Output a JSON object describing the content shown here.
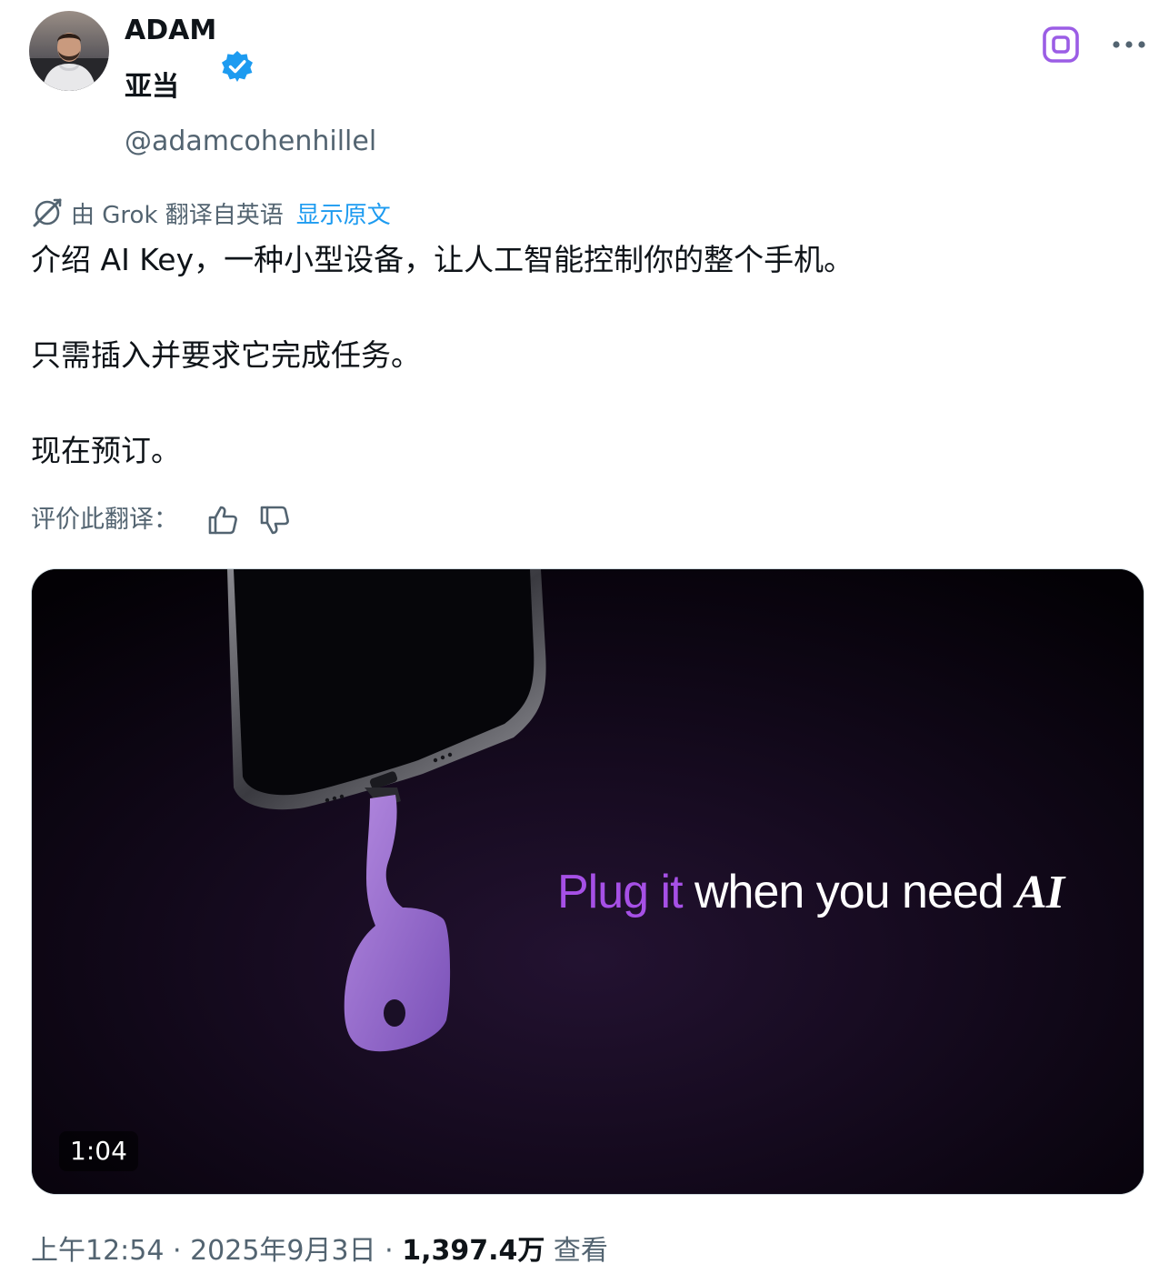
{
  "author": {
    "name_en": "ADAM",
    "name_zh": "亚当",
    "handle": "@adamcohenhillel",
    "verified": true,
    "avatar_icon": "person-avatar"
  },
  "header_actions": {
    "grok_icon": "grok-icon",
    "more_icon": "more-icon"
  },
  "translation": {
    "icon": "grok-translate-icon",
    "label": "由 Grok 翻译自英语",
    "show_original": "显示原文"
  },
  "tweet": {
    "lines": [
      "介绍 AI Key，一种小型设备，让人工智能控制你的整个手机。",
      "只需插入并要求它完成任务。",
      "现在预订。"
    ]
  },
  "rate_translation": {
    "label": "评价此翻译：",
    "thumbs_up_icon": "thumbs-up-icon",
    "thumbs_down_icon": "thumbs-down-icon"
  },
  "video": {
    "caption_highlight": "Plug it",
    "caption_rest": " when you need ",
    "caption_ai": "AI",
    "duration": "1:04"
  },
  "meta": {
    "time": "上午12:54",
    "sep1": " · ",
    "date": "2025年9月3日",
    "sep2": " · ",
    "views": "1,397.4万",
    "views_label": " 查看"
  },
  "colors": {
    "text_primary": "#0f1419",
    "text_secondary": "#536471",
    "link": "#1d9bf0",
    "verified": "#1d9bf0",
    "grok_accent": "#9b5de5",
    "caption_purple": "#a650e6",
    "video_bg": "#050208"
  }
}
